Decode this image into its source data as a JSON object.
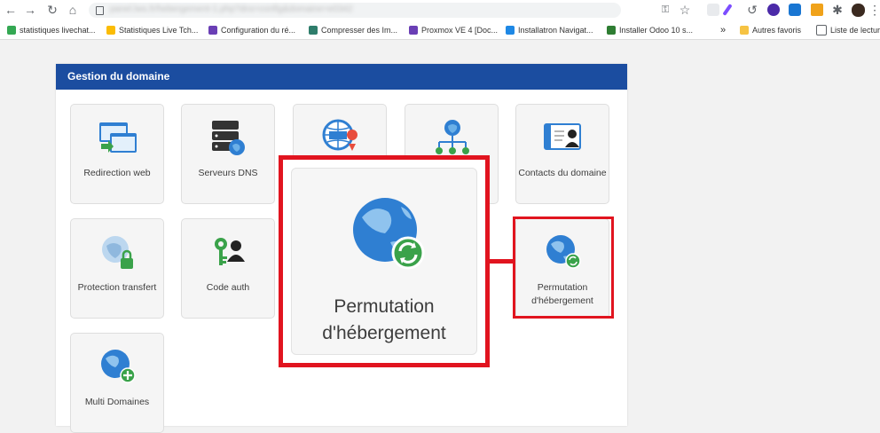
{
  "browser": {
    "url": "panel.lws.fr/hebergement-1.php?dns=config&domaine=e0342",
    "bookmarks": [
      {
        "label": "statistiques livechat...",
        "color": "#34a853"
      },
      {
        "label": "Statistiques Live Tch...",
        "color": "#fbbc05"
      },
      {
        "label": "Configuration du ré...",
        "color": "#6a3fb5"
      },
      {
        "label": "Compresser des Im...",
        "color": "#2e7d6b"
      },
      {
        "label": "Proxmox VE 4 [Doc...",
        "color": "#6a3fb5"
      },
      {
        "label": "Installatron Navigat...",
        "color": "#1e88e5"
      },
      {
        "label": "Installer Odoo 10 s...",
        "color": "#2e7d32"
      }
    ],
    "more_label": "»",
    "other_bookmarks": "Autres favoris",
    "reading_list": "Liste de lecture"
  },
  "panel": {
    "title": "Gestion du domaine",
    "tiles": [
      {
        "key": "redirection",
        "label": "Redirection web",
        "icon": "web-redirect-icon"
      },
      {
        "key": "dns-servers",
        "label": "Serveurs DNS",
        "icon": "dns-server-icon"
      },
      {
        "key": "dns-zone",
        "label": "",
        "icon": "dns-globe-pin-icon"
      },
      {
        "key": "subdomains",
        "label": "",
        "icon": "globe-network-icon"
      },
      {
        "key": "contacts",
        "label": "Contacts du domaine",
        "icon": "contact-card-icon"
      },
      {
        "key": "protection",
        "label": "Protection transfert",
        "icon": "globe-lock-icon"
      },
      {
        "key": "auth-code",
        "label": "Code auth",
        "icon": "key-user-icon"
      },
      {
        "key": "hosting-swap",
        "label": "Permutation d'hébergement",
        "icon": "globe-refresh-icon"
      },
      {
        "key": "multi-domains",
        "label": "Multi Domaines",
        "icon": "globe-plus-icon"
      }
    ]
  },
  "zoom": {
    "label": "Permutation d'hébergement",
    "icon": "globe-refresh-icon"
  },
  "colors": {
    "header": "#1b4da0",
    "highlight": "#e1141f",
    "globe": "#2f7fd2",
    "green": "#3aa24a"
  }
}
